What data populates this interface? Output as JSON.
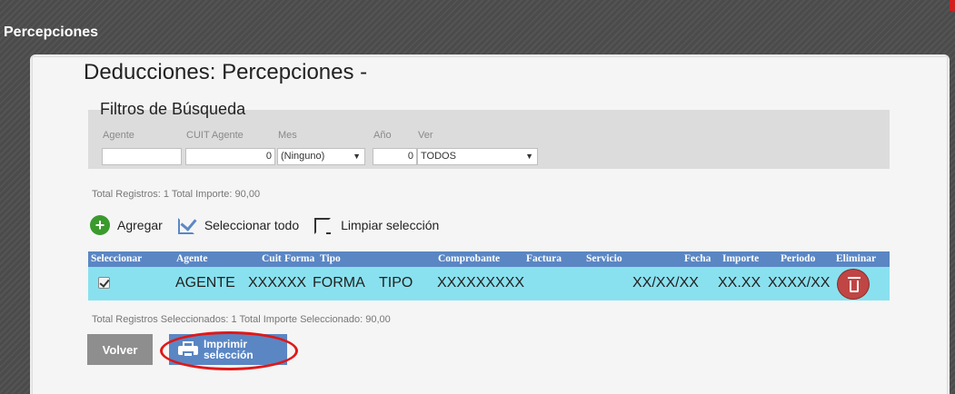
{
  "window": {
    "title": "Percepciones"
  },
  "page": {
    "heading": "Deducciones: Percepciones -"
  },
  "filters": {
    "title": "Filtros de Búsqueda",
    "labels": {
      "agente": "Agente",
      "cuit": "CUIT Agente",
      "mes": "Mes",
      "anio": "Año",
      "ver": "Ver"
    },
    "values": {
      "agente": "",
      "cuit": "0",
      "mes": "(Ninguno)",
      "anio": "0",
      "ver": "TODOS"
    }
  },
  "summary_top": "Total Registros: 1 Total Importe: 90,00",
  "actions": {
    "add": "Agregar",
    "select_all": "Seleccionar todo",
    "clear": "Limpiar selección"
  },
  "table": {
    "headers": [
      "Seleccionar",
      "Agente",
      "Cuit",
      "Forma",
      "Tipo",
      "Comprobante",
      "Factura",
      "Servicio",
      "Fecha",
      "Importe",
      "Periodo",
      "Eliminar"
    ],
    "rows": [
      {
        "selected": true,
        "agente": "AGENTE",
        "cuit": "XXXXXX",
        "forma": "FORMA",
        "tipo": "TIPO",
        "comprobante": "XXXXXXXXX",
        "fecha": "XX/XX/XX",
        "importe": "XX.XX",
        "periodo": "XXXX/XX"
      }
    ]
  },
  "summary_bottom": "Total Registros Seleccionados: 1 Total Importe Seleccionado: 90,00",
  "buttons": {
    "back": "Volver",
    "print_line1": "Imprimir",
    "print_line2": "selección"
  },
  "colors": {
    "header_blue": "#5a86c4",
    "row_cyan": "#89e1ef",
    "highlight_red": "#e01818",
    "add_green": "#3a9a2c",
    "delete_red": "#c04545"
  }
}
